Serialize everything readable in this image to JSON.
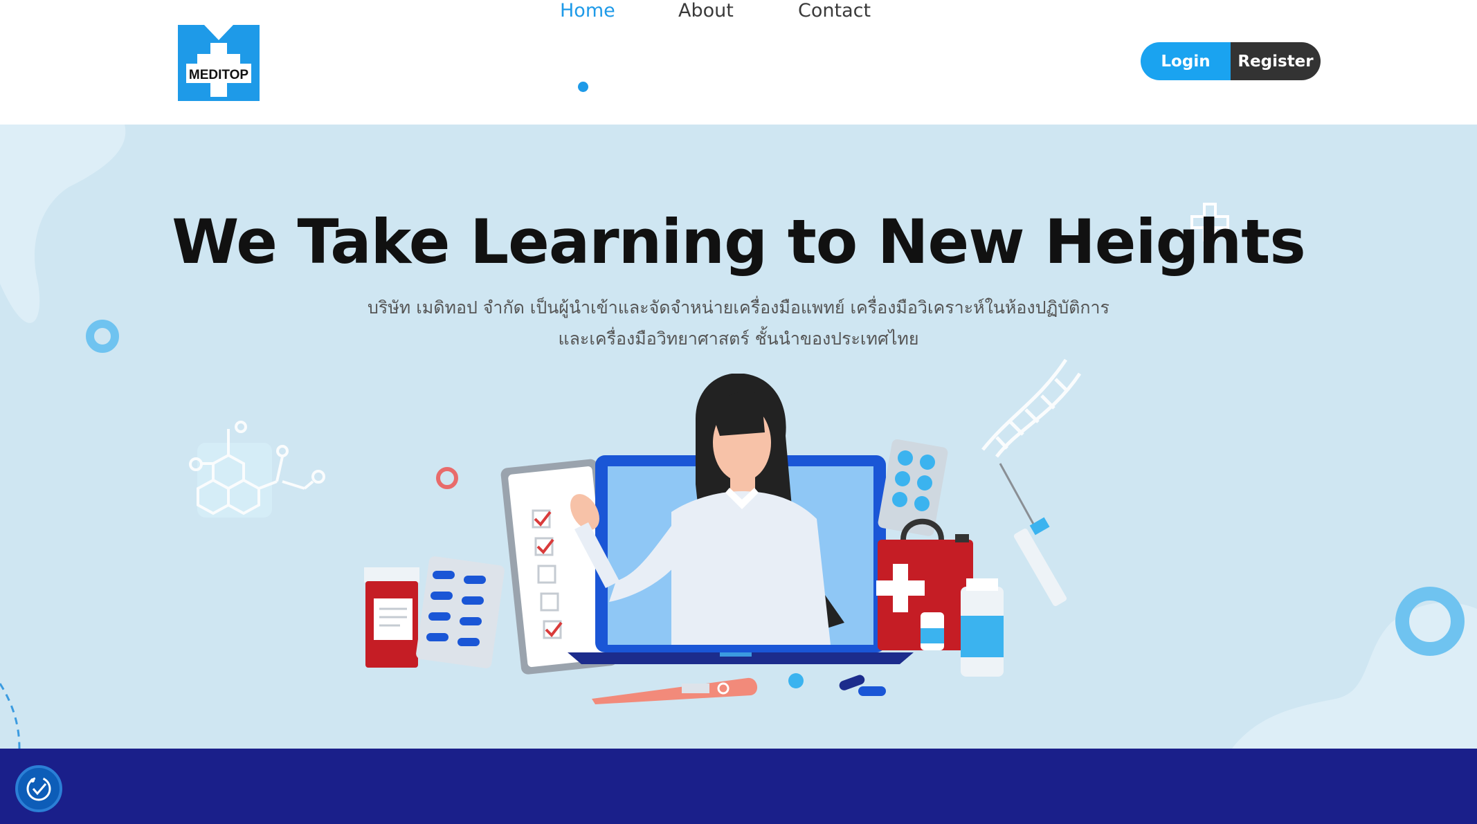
{
  "logo": {
    "text": "MEDITOP",
    "icon": "meditop-logo-icon"
  },
  "nav": {
    "items": [
      {
        "label": "Home",
        "active": true
      },
      {
        "label": "About",
        "active": false
      },
      {
        "label": "Contact",
        "active": false
      }
    ]
  },
  "auth": {
    "login_label": "Login",
    "register_label": "Register"
  },
  "hero": {
    "title": "We Take Learning to New Heights",
    "subtitle_line1": "บริษัท เมดิทอป จำกัด เป็นผู้นำเข้าและจัดจำหน่ายเครื่องมือแพทย์ เครื่องมือวิเคราะห์ในห้องปฏิบัติการ",
    "subtitle_line2": "และเครื่องมือวิทยาศาสตร์ ชั้นนำของประเทศไทย",
    "illustration": "doctor-laptop-medical-illustration"
  },
  "accessibility": {
    "icon": "accessibility-icon"
  },
  "colors": {
    "accent": "#1e9ae8",
    "login": "#1aa3f0",
    "register": "#333333",
    "hero_bg": "#cfe6f2",
    "footer_band": "#1a1f8a"
  }
}
